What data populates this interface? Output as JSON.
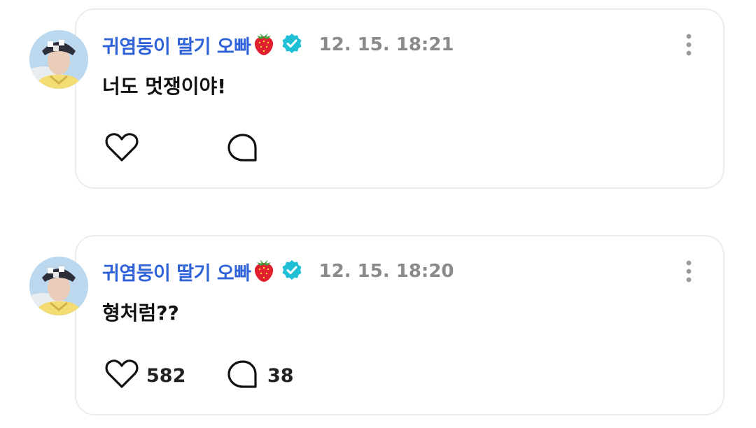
{
  "posts": [
    {
      "author": "귀염둥이 딸기 오빠",
      "timestamp": "12. 15. 18:21",
      "text": "너도 멋쟁이야!",
      "like_count": "",
      "comment_count": ""
    },
    {
      "author": "귀염둥이 딸기 오빠",
      "timestamp": "12. 15. 18:20",
      "text": "형처럼??",
      "like_count": "582",
      "comment_count": "38"
    }
  ],
  "icons": {
    "badge": "verified-icon",
    "emoji": "strawberry-icon",
    "menu": "more-vertical-icon",
    "like": "heart-icon",
    "comment": "comment-bubble-icon"
  },
  "colors": {
    "author": "#2f62d8",
    "timestamp": "#8a8a8a",
    "verified": "#1fbfd6",
    "card_border": "#ececec"
  }
}
